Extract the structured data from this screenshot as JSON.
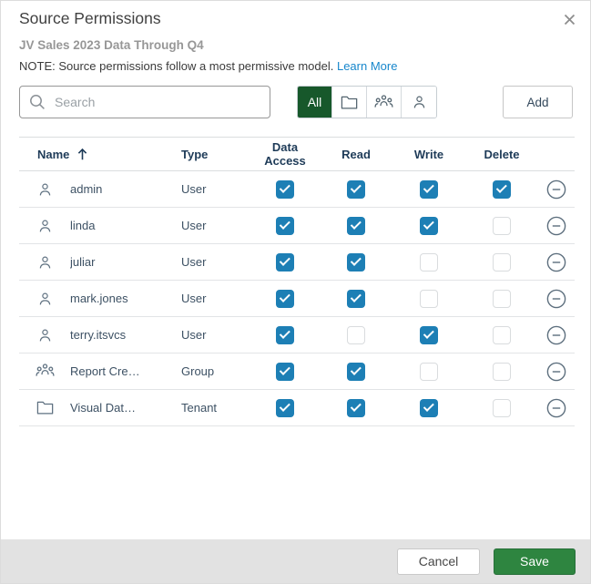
{
  "dialog": {
    "title": "Source Permissions",
    "subtitle": "JV Sales 2023 Data Through Q4",
    "note": "NOTE: Source permissions follow a most permissive model.",
    "learn_more_label": "Learn More"
  },
  "toolbar": {
    "search_placeholder": "Search",
    "filter_all_label": "All",
    "filter_icons": [
      "folder-icon",
      "group-icon",
      "user-icon"
    ],
    "add_label": "Add"
  },
  "table": {
    "headers": {
      "name": "Name",
      "type": "Type",
      "data_access": "Data Access",
      "read": "Read",
      "write": "Write",
      "delete": "Delete"
    },
    "sort": {
      "column": "Name",
      "direction": "ascending"
    },
    "rows": [
      {
        "icon": "user",
        "name": "admin",
        "type": "User",
        "data_access": true,
        "read": true,
        "write": true,
        "delete": true
      },
      {
        "icon": "user",
        "name": "linda",
        "type": "User",
        "data_access": true,
        "read": true,
        "write": true,
        "delete": false
      },
      {
        "icon": "user",
        "name": "juliar",
        "type": "User",
        "data_access": true,
        "read": true,
        "write": false,
        "delete": false
      },
      {
        "icon": "user",
        "name": "mark.jones",
        "type": "User",
        "data_access": true,
        "read": true,
        "write": false,
        "delete": false
      },
      {
        "icon": "user",
        "name": "terry.itsvcs",
        "type": "User",
        "data_access": true,
        "read": false,
        "write": true,
        "delete": false
      },
      {
        "icon": "group",
        "name": "Report Cre…",
        "type": "Group",
        "data_access": true,
        "read": true,
        "write": false,
        "delete": false
      },
      {
        "icon": "folder",
        "name": "Visual Dat…",
        "type": "Tenant",
        "data_access": true,
        "read": true,
        "write": true,
        "delete": false
      }
    ]
  },
  "footer": {
    "cancel_label": "Cancel",
    "save_label": "Save"
  },
  "colors": {
    "filter_selected_green": "#17582B",
    "save_green": "#2E8540",
    "checkbox_blue": "#1D7FB5",
    "link_blue": "#1787CC",
    "header_navy": "#1E3B58",
    "footer_gray": "#E2E2E2"
  }
}
